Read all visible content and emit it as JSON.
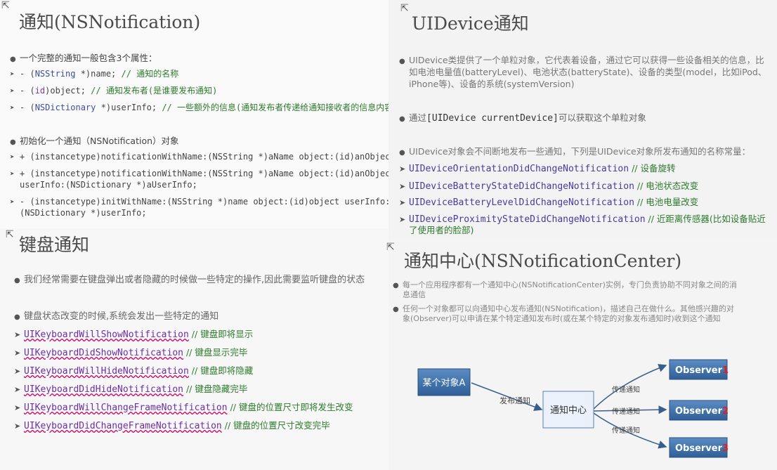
{
  "notification": {
    "title": "通知(NSNotification)",
    "props_heading": "一个完整的通知一般包含3个属性：",
    "props": [
      {
        "prefix": "- (",
        "type": "NSString",
        "mid": " *)name; ",
        "comment": "// 通知的名称"
      },
      {
        "prefix": "- (",
        "type": "id",
        "mid": ")object; ",
        "comment": "// 通知发布者(是谁要发布通知)"
      },
      {
        "prefix": "- (",
        "type": "NSDictionary",
        "mid": " *)userInfo; ",
        "comment": "// 一些额外的信息(通知发布者传递给通知接收者的信息内容)"
      }
    ],
    "init_heading": "初始化一个通知（NSNotification）对象",
    "init_lines": [
      "+ (instancetype)notificationWithName:(NSString *)aName object:(id)anObject;",
      "+ (instancetype)notificationWithName:(NSString *)aName object:(id)anObject",
      "userInfo:(NSDictionary *)aUserInfo;",
      "- (instancetype)initWithName:(NSString *)name object:(id)object userInfo:",
      "(NSDictionary *)userInfo;"
    ]
  },
  "device": {
    "title": "UIDevice通知",
    "intro_lines": [
      "UIDevice类提供了一个单粒对象，它代表着设备，通过它可以获得一些设备相关的信息，比",
      "如电池电量值(batteryLevel)、电池状态(batteryState)、设备的类型(model，比如iPod、",
      "iPhone等)、设备的系统(systemVersion)"
    ],
    "current_prefix": "通过",
    "current_code": "[UIDevice currentDevice]",
    "current_suffix": "可以获取这个单粒对象",
    "list_heading": "UIDevice对象会不间断地发布一些通知，下列是UIDevice对象所发布通知的名称常量：",
    "items": [
      {
        "name": "UIDeviceOrientationDidChangeNotification",
        "comment": "// 设备旋转"
      },
      {
        "name": "UIDeviceBatteryStateDidChangeNotification",
        "comment": "// 电池状态改变"
      },
      {
        "name": "UIDeviceBatteryLevelDidChangeNotification",
        "comment": "// 电池电量改变"
      },
      {
        "name": "UIDeviceProximityStateDidChangeNotification",
        "comment": "// 近距离传感器(比如设备贴近"
      }
    ],
    "item_continuation": "了使用者的脸部)"
  },
  "keyboard": {
    "title": "键盘通知",
    "intro": "我们经常需要在键盘弹出或者隐藏的时候做一些特定的操作,因此需要监听键盘的状态",
    "list_heading": "键盘状态改变的时候,系统会发出一些特定的通知",
    "items": [
      {
        "name": "UIKeyboardWillShowNotification",
        "comment": "// 键盘即将显示"
      },
      {
        "name": "UIKeyboardDidShowNotification",
        "comment": "// 键盘显示完毕"
      },
      {
        "name": "UIKeyboardWillHideNotification",
        "comment": "// 键盘即将隐藏"
      },
      {
        "name": "UIKeyboardDidHideNotification",
        "comment": "// 键盘隐藏完毕"
      },
      {
        "name": "UIKeyboardWillChangeFrameNotification",
        "comment": "// 键盘的位置尺寸即将发生改变"
      },
      {
        "name": "UIKeyboardDidChangeFrameNotification",
        "comment": "// 键盘的位置尺寸改变完毕"
      }
    ]
  },
  "center": {
    "title": "通知中心(NSNotificationCenter)",
    "p1_lines": [
      "每一个应用程序都有一个通知中心(NSNotificationCenter)实例，专门负责协助不同对象之间的消",
      "息通信"
    ],
    "p2_lines": [
      "任何一个对象都可以向通知中心发布通知(NSNotification)，描述自己在做什么。其他感兴趣的对",
      "象(Observer)可以申请在某个特定通知发布时(或在某个特定的对象发布通知时)收到这个通知"
    ],
    "diagram": {
      "source": "某个对象A",
      "post_label": "发布通知",
      "hub": "通知中心",
      "pass_label": "传递通知",
      "observer_word": "Observer",
      "observer_nums": [
        "1",
        "2",
        "3"
      ]
    }
  },
  "colors": {
    "box_fill": "#3e6fa8",
    "box_stroke": "#2a4f7c",
    "observer_num": "#e02020",
    "arrow": "#3a5e8c"
  }
}
